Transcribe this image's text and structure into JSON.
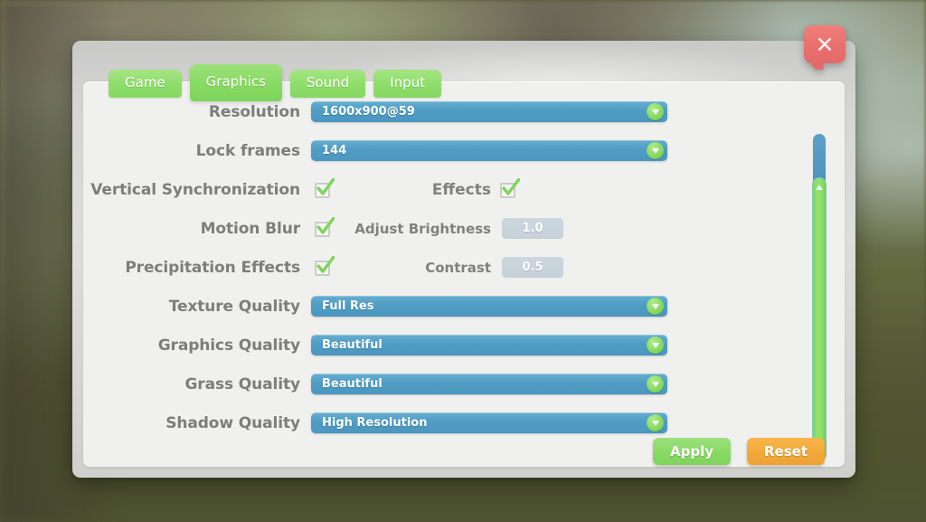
{
  "window": {
    "close_label": "✕",
    "close_icon": "close-x-icon"
  },
  "tabs": [
    {
      "label": "Game",
      "active": false
    },
    {
      "label": "Graphics",
      "active": true
    },
    {
      "label": "Sound",
      "active": false
    },
    {
      "label": "Input",
      "active": false
    }
  ],
  "settings": [
    {
      "label": "Resolution",
      "type": "dropdown",
      "value": "1600x900@59"
    },
    {
      "label": "Lock frames",
      "type": "dropdown",
      "value": "144"
    },
    {
      "label": "Vertical Synchronization",
      "type": "checkbox",
      "checked": true,
      "sub_label": "Effects",
      "sub_type": "checkbox",
      "sub_checked": true
    },
    {
      "label": "Motion Blur",
      "type": "checkbox",
      "checked": true,
      "sub_label": "Adjust Brightness",
      "sub_type": "value",
      "sub_value": "1.0"
    },
    {
      "label": "Precipitation Effects",
      "type": "checkbox",
      "checked": true,
      "sub_label": "Contrast",
      "sub_type": "value",
      "sub_value": "0.5"
    },
    {
      "label": "Texture Quality",
      "type": "dropdown",
      "value": "Full Res"
    },
    {
      "label": "Graphics Quality",
      "type": "dropdown",
      "value": "Beautiful"
    },
    {
      "label": "Grass Quality",
      "type": "dropdown",
      "value": "Beautiful"
    },
    {
      "label": "Shadow Quality",
      "type": "dropdown",
      "value": "High Resolution"
    }
  ],
  "scrollbar": {
    "thumb_position_percent": 13,
    "up_icon": "scroll-up-arrow-icon",
    "down_icon": "scroll-down-arrow-icon"
  },
  "footer": {
    "apply_label": "Apply",
    "reset_label": "Reset"
  },
  "colors": {
    "tab_green": "#8edd6b",
    "dropdown_blue": "#4f9cc4",
    "arrow_green": "#86d95f",
    "apply_green": "#88d964",
    "reset_orange": "#f2a93a",
    "close_red": "#e9706c",
    "label_gray": "#7d7d7d",
    "panel_bg": "#f0f0ee",
    "window_bg": "#d6d6d3",
    "scroll_track_blue": "#4d93bf",
    "scroll_thumb_green": "#8cdd69",
    "value_box_blue_gray": "#c9d4dd"
  }
}
